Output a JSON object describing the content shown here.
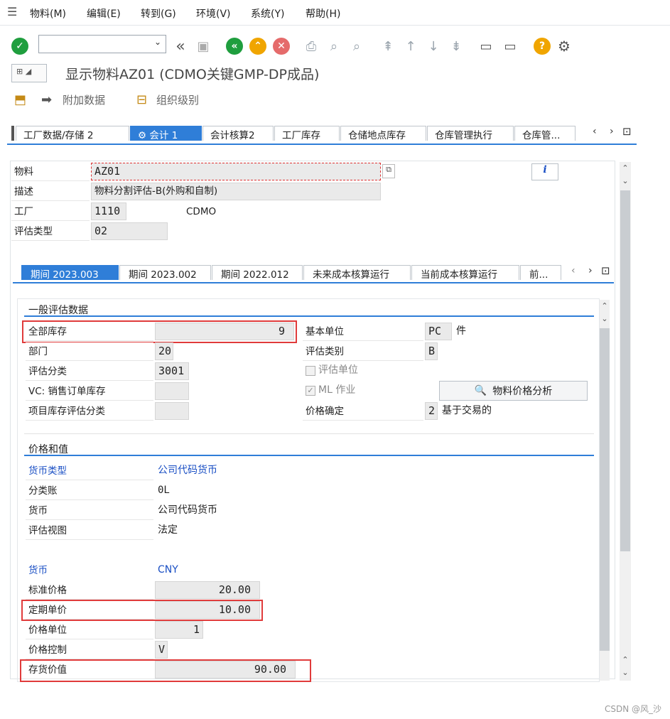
{
  "menu": [
    "物料(M)",
    "编辑(E)",
    "转到(G)",
    "环境(V)",
    "系统(Y)",
    "帮助(H)"
  ],
  "title": "显示物料AZ01 (CDMO关键GMP-DP成品)",
  "app_toolbar": {
    "additional_data": "附加数据",
    "org_levels": "组织级别"
  },
  "outer_tabs": [
    "工厂数据/存储 2",
    "会计 1",
    "会计核算2",
    "工厂库存",
    "仓储地点库存",
    "仓库管理执行",
    "仓库管..."
  ],
  "header": {
    "material_label": "物料",
    "material_value": "AZ01",
    "desc_label": "描述",
    "desc_value": "物料分割评估-B(外购和自制)",
    "plant_label": "工厂",
    "plant_value": "1110",
    "plant_name": "CDMO",
    "valtype_label": "评估类型",
    "valtype_value": "02"
  },
  "inner_tabs": [
    "期间 2023.003",
    "期间 2023.002",
    "期间 2022.012",
    "未来成本核算运行",
    "当前成本核算运行",
    "前..."
  ],
  "general": {
    "title": "一般评估数据",
    "total_stock_label": "全部库存",
    "total_stock_value": "9",
    "division_label": "部门",
    "division_value": "20",
    "valclass_label": "评估分类",
    "valclass_value": "3001",
    "vc_label": "VC: 销售订单库存",
    "proj_label": "项目库存评估分类",
    "base_uom_label": "基本单位",
    "base_uom_value": "PC",
    "base_uom_text": "件",
    "valcat_label": "评估类别",
    "valcat_value": "B",
    "valunit_label": "评估单位",
    "ml_label": "ML 作业",
    "price_analysis_button": "物料价格分析",
    "price_det_label": "价格确定",
    "price_det_value": "2",
    "price_det_text": "基于交易的"
  },
  "prices": {
    "title": "价格和值",
    "currency_type_label": "货币类型",
    "currency_type_value": "公司代码货币",
    "ledger_label": "分类账",
    "ledger_value": "0L",
    "currency_label": "货币",
    "currency_value": "公司代码货币",
    "view_label": "评估视图",
    "view_value": "法定",
    "curr2_label": "货币",
    "curr2_value": "CNY",
    "std_price_label": "标准价格",
    "std_price_value": "20.00",
    "periodic_price_label": "定期单价",
    "periodic_price_value": "10.00",
    "price_unit_label": "价格单位",
    "price_unit_value": "1",
    "price_control_label": "价格控制",
    "price_control_value": "V",
    "inventory_value_label": "存货价值",
    "inventory_value_value": "90.00"
  },
  "watermark": "CSDN @风_沙"
}
